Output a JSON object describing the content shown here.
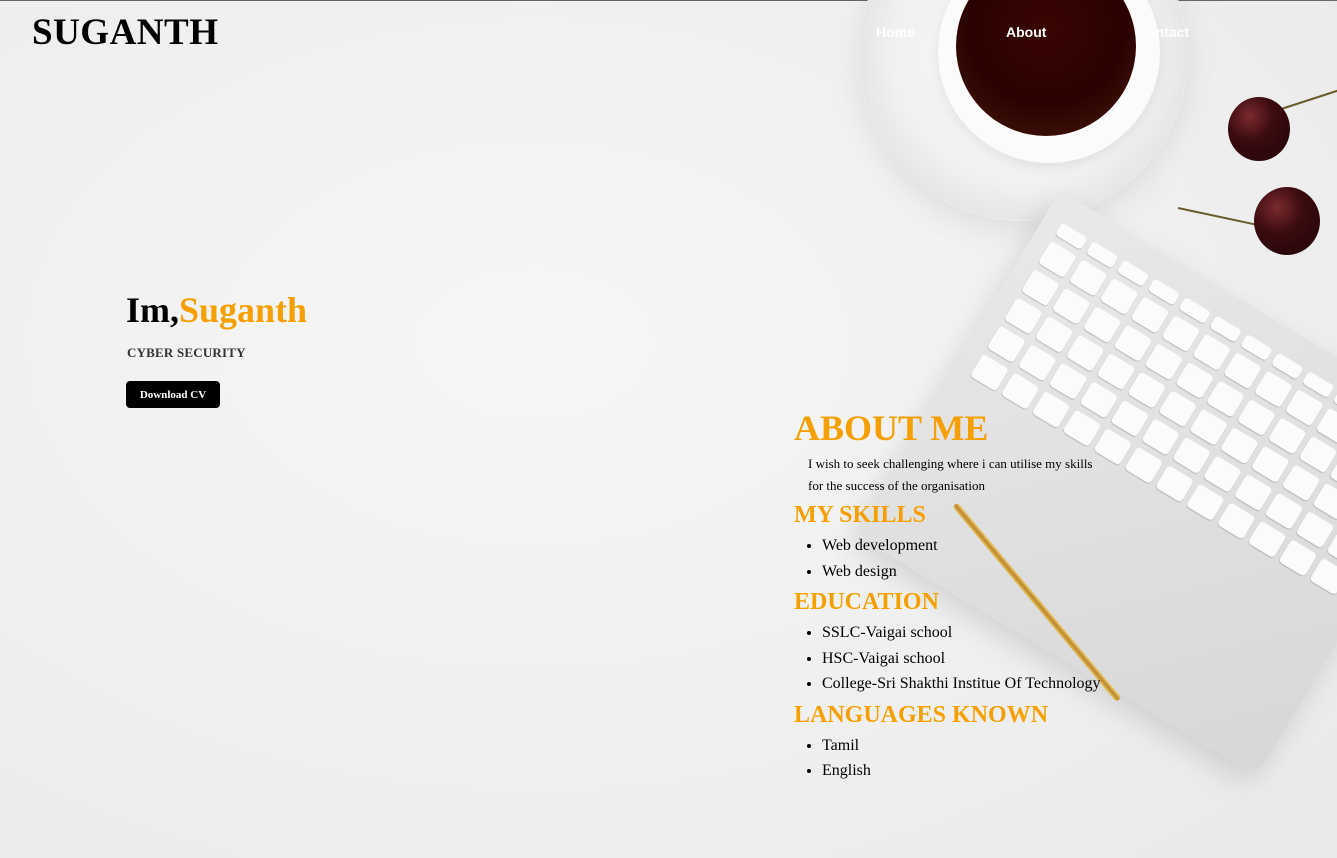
{
  "header": {
    "logo": "SUGANTH",
    "nav": [
      "Home",
      "About",
      "Contact"
    ]
  },
  "hero": {
    "greeting": "Im,",
    "name": "Suganth",
    "subtitle": "CYBER SECURITY",
    "cta_label": "Download CV"
  },
  "about": {
    "title": "ABOUT ME",
    "description": "I wish to seek challenging where i can utilise my skills for the success of the organisation",
    "skills_title": "MY SKILLS",
    "skills": [
      "Web development",
      "Web design"
    ],
    "education_title": "EDUCATION",
    "education": [
      "SSLC-Vaigai school",
      "HSC-Vaigai school",
      "College-Sri Shakthi Institue Of Technology"
    ],
    "languages_title": "LANGUAGES KNOWN",
    "languages": [
      "Tamil",
      "English"
    ]
  },
  "colors": {
    "accent": "#f5a000",
    "text": "#000000",
    "background": "#efefef"
  }
}
